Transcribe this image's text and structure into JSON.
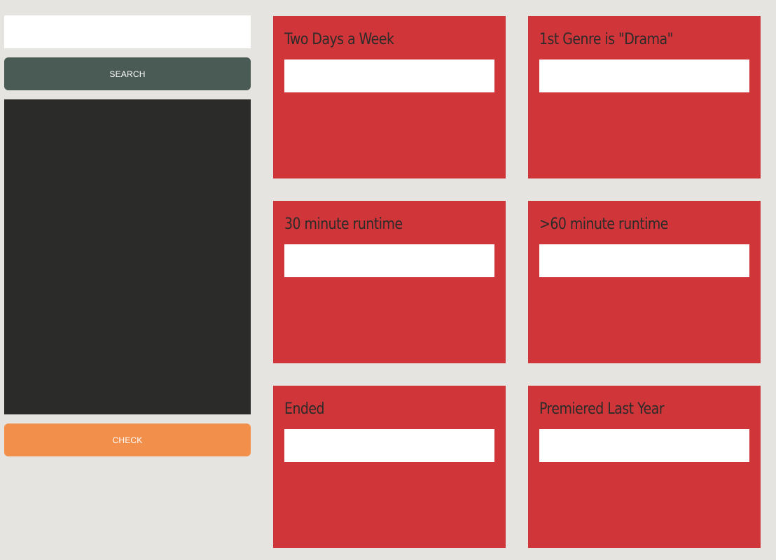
{
  "sidebar": {
    "search": {
      "value": "",
      "placeholder": ""
    },
    "search_label": "Search",
    "check_label": "Check"
  },
  "cards": [
    {
      "title": "Two Days a Week"
    },
    {
      "title": "1st Genre is \"Drama\""
    },
    {
      "title": "30 minute runtime"
    },
    {
      "title": ">60 minute runtime"
    },
    {
      "title": "Ended"
    },
    {
      "title": "Premiered Last Year"
    }
  ],
  "colors": {
    "background": "#e6e4e0",
    "card": "#d0353a",
    "search_button": "#4a5a55",
    "check_button": "#f2904b",
    "results_panel": "#2b2b29"
  }
}
